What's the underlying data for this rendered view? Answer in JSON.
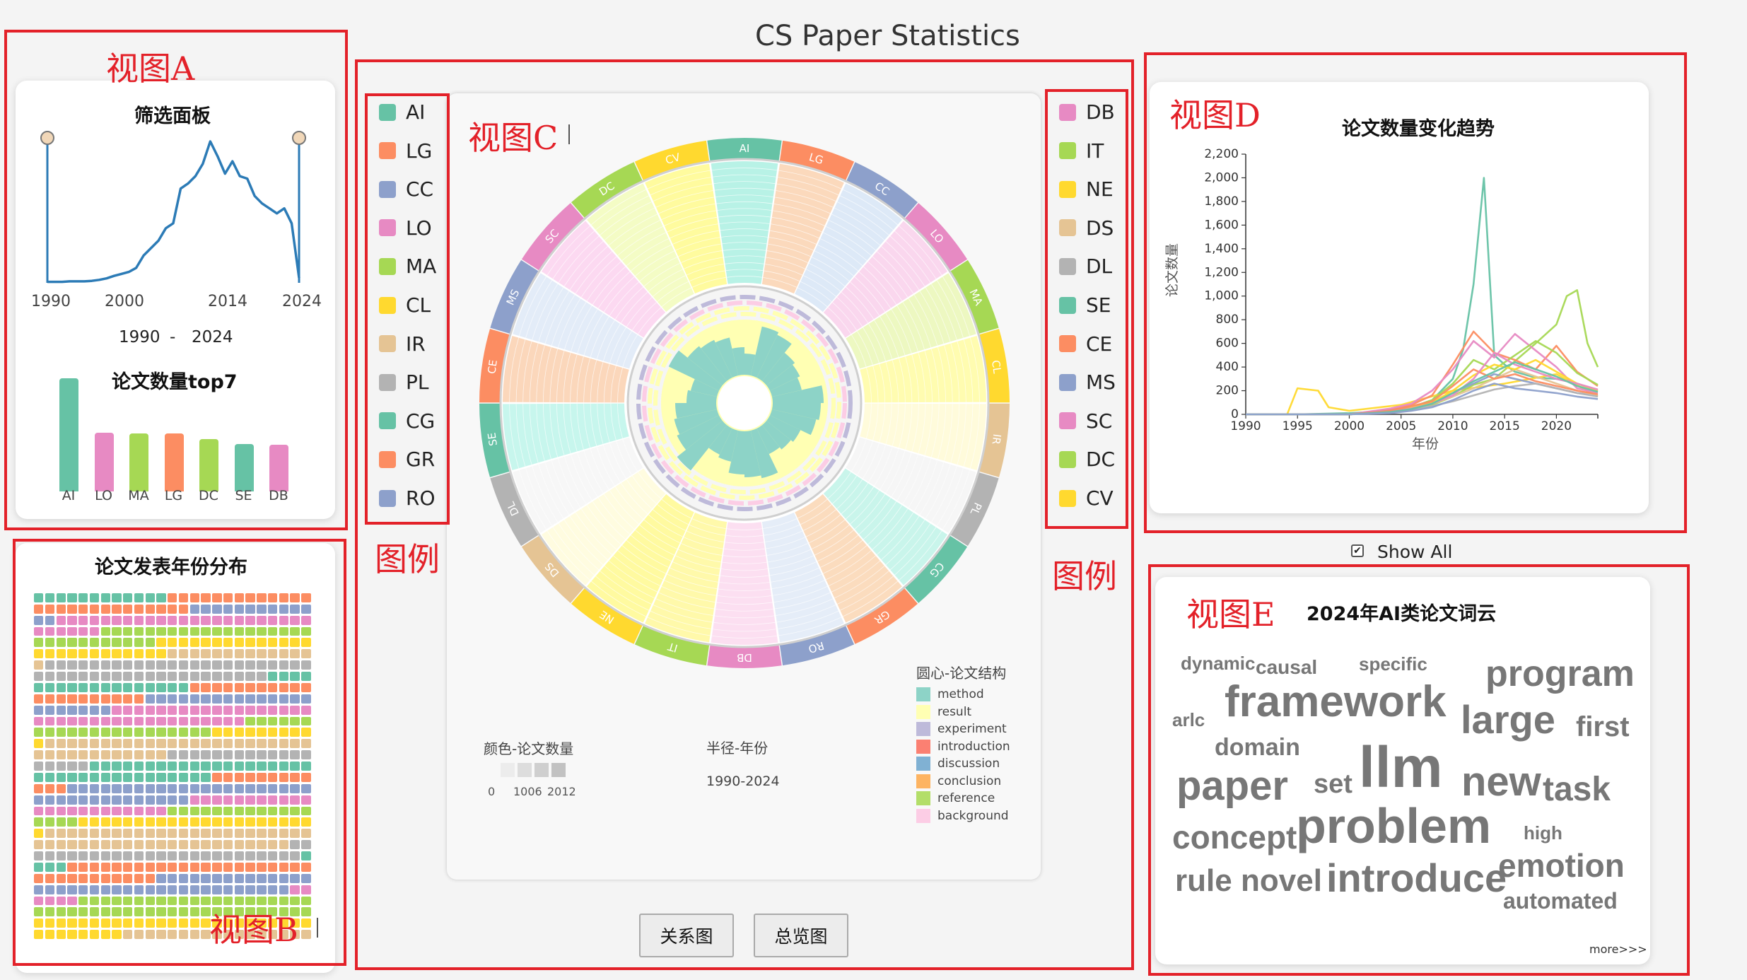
{
  "page": {
    "title": "CS Paper Statistics"
  },
  "annotations": {
    "view_a": "视图A",
    "view_b": "视图B",
    "view_c": "视图C",
    "view_d": "视图D",
    "view_e": "视图E",
    "legend_left": "图例",
    "legend_right": "图例"
  },
  "colors": {
    "accent_red": "#e32129",
    "line_blue": "#2c7bb6"
  },
  "filter_panel": {
    "title": "筛选面板",
    "axis_labels": [
      "1990",
      "2000",
      "2014",
      "2024"
    ],
    "range_start": "1990",
    "range_dash": "-",
    "range_end": "2024",
    "density_series": [
      2,
      2,
      2,
      3,
      3,
      3,
      4,
      6,
      9,
      14,
      18,
      22,
      30,
      55,
      70,
      85,
      110,
      120,
      190,
      200,
      215,
      240,
      285,
      255,
      220,
      245,
      215,
      210,
      175,
      160,
      150,
      140,
      150,
      120,
      10
    ]
  },
  "top7": {
    "title": "论文数量top7",
    "items": [
      {
        "label": "AI",
        "value": 100,
        "color": "#66c2a5"
      },
      {
        "label": "LO",
        "value": 52,
        "color": "#e78ac3"
      },
      {
        "label": "MA",
        "value": 51,
        "color": "#a6d854"
      },
      {
        "label": "LG",
        "value": 51,
        "color": "#fc8d62"
      },
      {
        "label": "DC",
        "value": 46,
        "color": "#a6d854"
      },
      {
        "label": "SE",
        "value": 42,
        "color": "#66c2a5"
      },
      {
        "label": "DB",
        "value": 41,
        "color": "#e78ac3"
      }
    ]
  },
  "waffle": {
    "title": "论文发表年份分布",
    "rows": 31,
    "cols": 25,
    "palette": [
      "#66c2a5",
      "#fc8d62",
      "#8da0cb",
      "#e78ac3",
      "#a6d854",
      "#ffd92f",
      "#e5c494",
      "#b3b3b3"
    ]
  },
  "legend_left": [
    {
      "label": "AI",
      "color": "#66c2a5"
    },
    {
      "label": "LG",
      "color": "#fc8d62"
    },
    {
      "label": "CC",
      "color": "#8da0cb"
    },
    {
      "label": "LO",
      "color": "#e78ac3"
    },
    {
      "label": "MA",
      "color": "#a6d854"
    },
    {
      "label": "CL",
      "color": "#ffd92f"
    },
    {
      "label": "IR",
      "color": "#e5c494"
    },
    {
      "label": "PL",
      "color": "#b3b3b3"
    },
    {
      "label": "CG",
      "color": "#66c2a5"
    },
    {
      "label": "GR",
      "color": "#fc8d62"
    },
    {
      "label": "RO",
      "color": "#8da0cb"
    }
  ],
  "legend_right": [
    {
      "label": "DB",
      "color": "#e78ac3"
    },
    {
      "label": "IT",
      "color": "#a6d854"
    },
    {
      "label": "NE",
      "color": "#ffd92f"
    },
    {
      "label": "DS",
      "color": "#e5c494"
    },
    {
      "label": "DL",
      "color": "#b3b3b3"
    },
    {
      "label": "SE",
      "color": "#66c2a5"
    },
    {
      "label": "CE",
      "color": "#fc8d62"
    },
    {
      "label": "MS",
      "color": "#8da0cb"
    },
    {
      "label": "SC",
      "color": "#e78ac3"
    },
    {
      "label": "DC",
      "color": "#a6d854"
    },
    {
      "label": "CV",
      "color": "#ffd92f"
    }
  ],
  "radial": {
    "categories": [
      {
        "label": "AI",
        "color": "#66c2a5",
        "light": "#b8f2e6",
        "density": 1.0
      },
      {
        "label": "LG",
        "color": "#fc8d62",
        "light": "#fbd5b5",
        "density": 0.8
      },
      {
        "label": "CC",
        "color": "#8da0cb",
        "light": "#d6e4f5",
        "density": 0.6
      },
      {
        "label": "LO",
        "color": "#e78ac3",
        "light": "#f9d3ec",
        "density": 0.8
      },
      {
        "label": "MA",
        "color": "#a6d854",
        "light": "#eaf7b8",
        "density": 0.7
      },
      {
        "label": "CL",
        "color": "#ffd92f",
        "light": "#fffcb0",
        "density": 1.0
      },
      {
        "label": "IR",
        "color": "#e5c494",
        "light": "#fffad0",
        "density": 0.5
      },
      {
        "label": "PL",
        "color": "#b3b3b3",
        "light": "#f2f2f2",
        "density": 0.3
      },
      {
        "label": "CG",
        "color": "#66c2a5",
        "light": "#c7f5ea",
        "density": 0.9
      },
      {
        "label": "GR",
        "color": "#fc8d62",
        "light": "#fbd8b8",
        "density": 0.8
      },
      {
        "label": "RO",
        "color": "#8da0cb",
        "light": "#dfe9f7",
        "density": 0.6
      },
      {
        "label": "DB",
        "color": "#e78ac3",
        "light": "#fbd8ee",
        "density": 0.6
      },
      {
        "label": "IT",
        "color": "#a6d854",
        "light": "#fff9a6",
        "density": 0.9
      },
      {
        "label": "NE",
        "color": "#ffd92f",
        "light": "#fffaa0",
        "density": 1.0
      },
      {
        "label": "DS",
        "color": "#e5c494",
        "light": "#fffbd5",
        "density": 0.4
      },
      {
        "label": "DL",
        "color": "#b3b3b3",
        "light": "#f4f4f4",
        "density": 0.3
      },
      {
        "label": "SE",
        "color": "#66c2a5",
        "light": "#c4f6ec",
        "density": 0.9
      },
      {
        "label": "CE",
        "color": "#fc8d62",
        "light": "#fbd3b4",
        "density": 0.8
      },
      {
        "label": "MS",
        "color": "#8da0cb",
        "light": "#dde8f7",
        "density": 0.6
      },
      {
        "label": "SC",
        "color": "#e78ac3",
        "light": "#fbd3ef",
        "density": 0.7
      },
      {
        "label": "DC",
        "color": "#a6d854",
        "light": "#f2fbb8",
        "density": 0.6
      },
      {
        "label": "CV",
        "color": "#ffd92f",
        "light": "#fffb9e",
        "density": 1.0
      }
    ],
    "color_legend": {
      "title": "颜色-论文数量",
      "ticks": [
        "0",
        "1006",
        "2012"
      ],
      "swatches": [
        "#f8f8f8",
        "#ececec",
        "#dddddd",
        "#cfcfcf",
        "#c2c2c2"
      ]
    },
    "radius_legend": {
      "title": "半径-年份",
      "range": "1990-2024"
    },
    "structure_legend": {
      "title": "圆心-论文结构",
      "items": [
        {
          "label": "method",
          "color": "#8dd3c7"
        },
        {
          "label": "result",
          "color": "#ffffb3"
        },
        {
          "label": "experiment",
          "color": "#bebada"
        },
        {
          "label": "introduction",
          "color": "#fb8072"
        },
        {
          "label": "discussion",
          "color": "#80b1d3"
        },
        {
          "label": "conclusion",
          "color": "#fdb462"
        },
        {
          "label": "reference",
          "color": "#b3de69"
        },
        {
          "label": "background",
          "color": "#fccde5"
        }
      ]
    }
  },
  "buttons": {
    "relation": "关系图",
    "overview": "总览图"
  },
  "chart_data": {
    "type": "line",
    "title": "论文数量变化趋势",
    "xlabel": "年份",
    "ylabel": "论文数量",
    "xlim": [
      1990,
      2024
    ],
    "ylim": [
      0,
      2200
    ],
    "xticks": [
      "1990",
      "1995",
      "2000",
      "2005",
      "2010",
      "2015",
      "2020"
    ],
    "yticks": [
      "0",
      "200",
      "400",
      "600",
      "800",
      "1,000",
      "1,200",
      "1,400",
      "1,600",
      "1,800",
      "2,000",
      "2,200"
    ],
    "series": [
      {
        "color": "#66c2a5",
        "x": [
          1990,
          1995,
          2000,
          2002,
          2004,
          2006,
          2008,
          2010,
          2011,
          2012,
          2013,
          2014,
          2015,
          2016,
          2018,
          2020,
          2022,
          2024
        ],
        "y": [
          0,
          0,
          10,
          20,
          40,
          60,
          120,
          300,
          550,
          1100,
          2000,
          500,
          420,
          360,
          310,
          300,
          260,
          200
        ]
      },
      {
        "color": "#ffd92f",
        "x": [
          1990,
          1994,
          1995,
          1997,
          1998,
          2000,
          2005,
          2010,
          2015,
          2020,
          2024
        ],
        "y": [
          0,
          0,
          220,
          200,
          60,
          30,
          80,
          200,
          260,
          340,
          150
        ]
      },
      {
        "color": "#a6d854",
        "x": [
          1990,
          2000,
          2005,
          2008,
          2010,
          2012,
          2014,
          2016,
          2018,
          2020,
          2021,
          2022,
          2023,
          2024
        ],
        "y": [
          0,
          0,
          30,
          80,
          150,
          250,
          300,
          450,
          600,
          760,
          1000,
          1050,
          600,
          400
        ]
      },
      {
        "color": "#fc8d62",
        "x": [
          1990,
          2000,
          2004,
          2006,
          2008,
          2010,
          2012,
          2014,
          2016,
          2018,
          2020,
          2022,
          2024
        ],
        "y": [
          0,
          0,
          40,
          80,
          160,
          420,
          700,
          520,
          460,
          380,
          580,
          360,
          240
        ]
      },
      {
        "color": "#e78ac3",
        "x": [
          1990,
          2000,
          2004,
          2006,
          2008,
          2010,
          2012,
          2014,
          2016,
          2018,
          2020,
          2022,
          2024
        ],
        "y": [
          0,
          0,
          50,
          90,
          200,
          380,
          620,
          480,
          680,
          540,
          400,
          220,
          180
        ]
      },
      {
        "color": "#8da0cb",
        "x": [
          1990,
          2000,
          2004,
          2006,
          2008,
          2010,
          2012,
          2014,
          2016,
          2018,
          2020,
          2022,
          2024
        ],
        "y": [
          0,
          0,
          30,
          60,
          100,
          180,
          260,
          340,
          300,
          260,
          220,
          180,
          160
        ]
      },
      {
        "color": "#e5c494",
        "x": [
          1990,
          2000,
          2004,
          2006,
          2008,
          2010,
          2012,
          2014,
          2016,
          2018,
          2020,
          2022,
          2024
        ],
        "y": [
          0,
          0,
          20,
          50,
          90,
          150,
          220,
          300,
          380,
          320,
          260,
          200,
          160
        ]
      },
      {
        "color": "#b3b3b3",
        "x": [
          1990,
          2000,
          2004,
          2006,
          2008,
          2010,
          2012,
          2014,
          2016,
          2018,
          2020,
          2022,
          2024
        ],
        "y": [
          0,
          0,
          15,
          40,
          70,
          110,
          160,
          210,
          240,
          260,
          220,
          180,
          150
        ]
      },
      {
        "color": "#a6d854",
        "x": [
          1990,
          2000,
          2004,
          2006,
          2008,
          2010,
          2012,
          2014,
          2016,
          2018,
          2020,
          2022,
          2024
        ],
        "y": [
          0,
          0,
          20,
          60,
          120,
          260,
          460,
          380,
          500,
          620,
          520,
          350,
          250
        ]
      },
      {
        "color": "#ffd92f",
        "x": [
          1990,
          2000,
          2004,
          2006,
          2008,
          2010,
          2012,
          2014,
          2016,
          2018,
          2020,
          2022,
          2024
        ],
        "y": [
          0,
          0,
          25,
          55,
          100,
          200,
          330,
          420,
          380,
          460,
          360,
          260,
          200
        ]
      },
      {
        "color": "#fc8d62",
        "x": [
          1990,
          2000,
          2004,
          2006,
          2008,
          2010,
          2012,
          2014,
          2016,
          2018,
          2020,
          2022,
          2024
        ],
        "y": [
          0,
          0,
          30,
          70,
          110,
          240,
          380,
          300,
          340,
          280,
          240,
          200,
          170
        ]
      },
      {
        "color": "#e78ac3",
        "x": [
          1990,
          2000,
          2004,
          2006,
          2008,
          2010,
          2012,
          2014,
          2016,
          2018,
          2020,
          2022,
          2024
        ],
        "y": [
          0,
          0,
          20,
          50,
          90,
          160,
          300,
          520,
          420,
          360,
          300,
          260,
          210
        ]
      },
      {
        "color": "#66c2a5",
        "x": [
          1990,
          2000,
          2004,
          2006,
          2008,
          2010,
          2012,
          2014,
          2016,
          2018,
          2020,
          2022,
          2024
        ],
        "y": [
          0,
          0,
          20,
          45,
          90,
          180,
          280,
          360,
          440,
          380,
          320,
          240,
          190
        ]
      },
      {
        "color": "#8da0cb",
        "x": [
          1990,
          2000,
          2004,
          2006,
          2008,
          2010,
          2012,
          2014,
          2016,
          2018,
          2020,
          2022,
          2024
        ],
        "y": [
          0,
          0,
          10,
          30,
          60,
          120,
          200,
          260,
          220,
          200,
          180,
          150,
          130
        ]
      }
    ]
  },
  "show_all": {
    "label": "Show All",
    "checked": true
  },
  "wordcloud": {
    "title": "2024年AI类论文词云",
    "more": "more>>>",
    "words": [
      {
        "text": "dynamic",
        "size": 26
      },
      {
        "text": "causal",
        "size": 28
      },
      {
        "text": "specific",
        "size": 26
      },
      {
        "text": "program",
        "size": 52
      },
      {
        "text": "arlc",
        "size": 26
      },
      {
        "text": "framework",
        "size": 62
      },
      {
        "text": "large",
        "size": 56
      },
      {
        "text": "first",
        "size": 40
      },
      {
        "text": "domain",
        "size": 34
      },
      {
        "text": "paper",
        "size": 58
      },
      {
        "text": "set",
        "size": 38
      },
      {
        "text": "llm",
        "size": 82
      },
      {
        "text": "new",
        "size": 58
      },
      {
        "text": "task",
        "size": 48
      },
      {
        "text": "concept",
        "size": 46
      },
      {
        "text": "problem",
        "size": 70
      },
      {
        "text": "high",
        "size": 26
      },
      {
        "text": "emotion",
        "size": 46
      },
      {
        "text": "rule",
        "size": 44
      },
      {
        "text": "novel",
        "size": 44
      },
      {
        "text": "introduce",
        "size": 56
      },
      {
        "text": "automated",
        "size": 32
      }
    ]
  }
}
